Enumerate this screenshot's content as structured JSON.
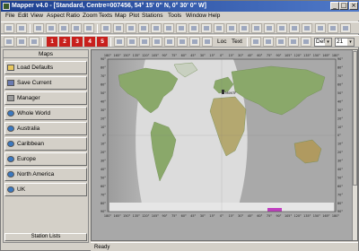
{
  "window": {
    "title": "Mapper v4.0 - [Standard, Centre=007456, 54° 15' 0\" N, 0° 30' 0\" W]",
    "minimize": "_",
    "maximize": "□",
    "close": "×"
  },
  "menu": [
    "File",
    "Edit",
    "View",
    "Aspect Ratio",
    "Zoom",
    "Texts",
    "Map",
    "Plot",
    "Stations",
    "Tools",
    "Window",
    "Help"
  ],
  "toolbar1": {
    "zoom_value": "Def",
    "zoom_level": "21"
  },
  "toolbar2": {
    "red_buttons": [
      "1",
      "2",
      "3",
      "4",
      "5"
    ],
    "loc_label": "Loc",
    "text_label": "Text"
  },
  "left_panel": {
    "header": "Maps",
    "items": [
      {
        "label": "Load Defaults",
        "icon": "folder-icon"
      },
      {
        "label": "Save Current",
        "icon": "save-icon"
      },
      {
        "label": "Manager",
        "icon": "manager-icon"
      },
      {
        "label": "Whole World",
        "icon": "globe-icon"
      },
      {
        "label": "Australia",
        "icon": "globe-icon"
      },
      {
        "label": "Caribbean",
        "icon": "globe-icon"
      },
      {
        "label": "Europe",
        "icon": "globe-icon"
      },
      {
        "label": "North America",
        "icon": "globe-icon"
      },
      {
        "label": "UK",
        "icon": "globe-icon"
      }
    ],
    "footer": "Station Lists"
  },
  "map": {
    "station_label": "M0NTF",
    "lon_ticks": [
      "180°",
      "165°",
      "150°",
      "135°",
      "120°",
      "105°",
      "90°",
      "75°",
      "60°",
      "45°",
      "30°",
      "15°",
      "0°",
      "15°",
      "30°",
      "45°",
      "60°",
      "75°",
      "90°",
      "105°",
      "120°",
      "135°",
      "150°",
      "165°",
      "180°"
    ],
    "lat_ticks": [
      "90°",
      "80°",
      "70°",
      "60°",
      "50°",
      "40°",
      "30°",
      "20°",
      "10°",
      "0°",
      "10°",
      "20°",
      "30°",
      "40°",
      "50°",
      "60°",
      "70°",
      "80°",
      "90°"
    ]
  },
  "status": {
    "text": "Ready"
  },
  "colors": {
    "title_bar_start": "#1c3f8f",
    "title_bar_end": "#4f79c9",
    "chrome": "#d4d0c8",
    "red_button": "#c8201c",
    "ocean": "#dcdcdc",
    "night": "#a6a6a6",
    "land": "#8aa86a"
  }
}
